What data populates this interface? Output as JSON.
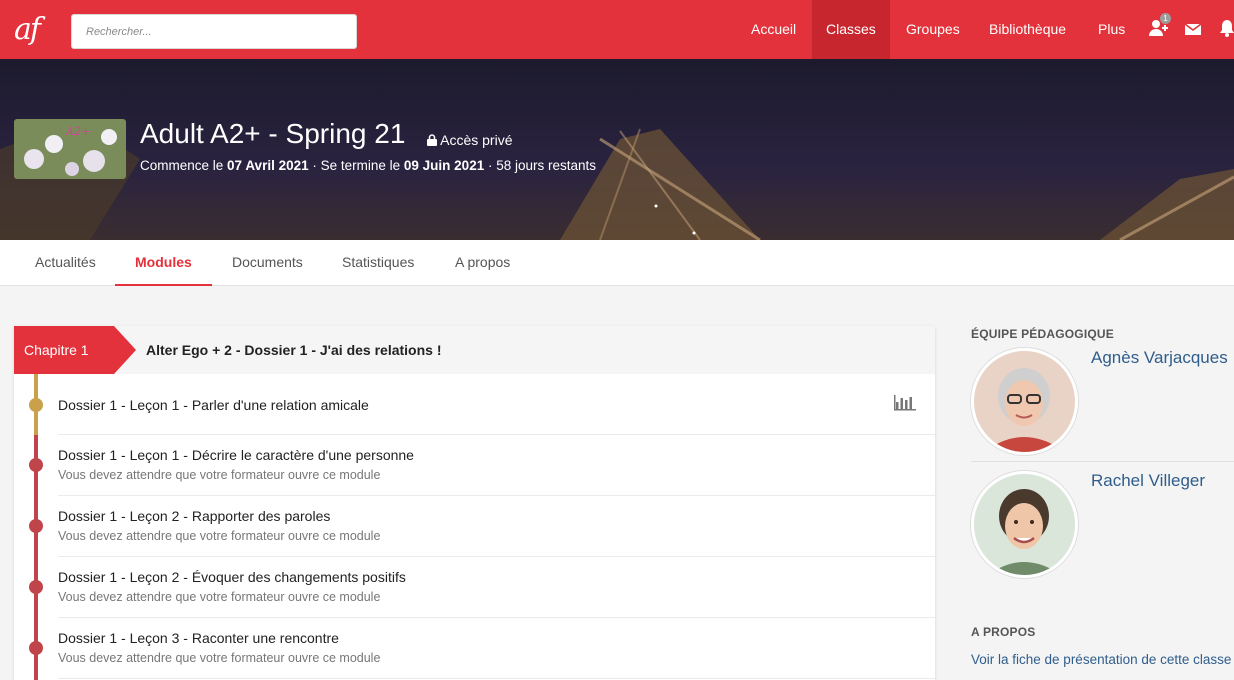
{
  "nav": {
    "logo": "af",
    "search_placeholder": "Rechercher...",
    "items": [
      {
        "label": "Accueil"
      },
      {
        "label": "Classes"
      },
      {
        "label": "Groupes"
      },
      {
        "label": "Bibliothèque"
      },
      {
        "label": "Plus"
      }
    ],
    "active_item": "Classes",
    "invite_badge": "1",
    "icons": [
      "add-user-icon",
      "mail-icon",
      "bell-icon"
    ]
  },
  "banner": {
    "thumbnail_text": "A2+",
    "title": "Adult A2+ - Spring 21",
    "access": "Accès privé",
    "dates": {
      "start_prefix": "Commence le ",
      "start": "07 Avril 2021",
      "end_prefix": " · Se termine le ",
      "end": "09 Juin 2021",
      "remaining": " · 58 jours restants"
    }
  },
  "tabs": [
    {
      "label": "Actualités"
    },
    {
      "label": "Modules"
    },
    {
      "label": "Documents"
    },
    {
      "label": "Statistiques"
    },
    {
      "label": "A propos"
    }
  ],
  "active_tab": "Modules",
  "chapter": {
    "label": "Chapitre 1",
    "title": "Alter Ego + 2 - Dossier 1 - J'ai des relations !"
  },
  "modules": [
    {
      "title": "Dossier 1 - Leçon 1 - Parler d'une relation amicale",
      "subtitle": "",
      "status": "open"
    },
    {
      "title": "Dossier 1 - Leçon 1 - Décrire le caractère d'une personne",
      "subtitle": "Vous devez attendre que votre formateur ouvre ce module",
      "status": "locked"
    },
    {
      "title": "Dossier 1 - Leçon 2 - Rapporter des paroles",
      "subtitle": "Vous devez attendre que votre formateur ouvre ce module",
      "status": "locked"
    },
    {
      "title": "Dossier 1 - Leçon 2 - Évoquer des changements positifs",
      "subtitle": "Vous devez attendre que votre formateur ouvre ce module",
      "status": "locked"
    },
    {
      "title": "Dossier 1 - Leçon 3 - Raconter une rencontre",
      "subtitle": "Vous devez attendre que votre formateur ouvre ce module",
      "status": "locked"
    }
  ],
  "sidebar": {
    "team_heading": "ÉQUIPE PÉDAGOGIQUE",
    "teachers": [
      {
        "name": "Agnès Varjacques"
      },
      {
        "name": "Rachel Villeger"
      }
    ],
    "about_heading": "A PROPOS",
    "about_link": "Voir la fiche de présentation de cette classe"
  },
  "colors": {
    "brand_red": "#e3323b",
    "open_dot": "#c9a14a",
    "locked_dot": "#c0454a",
    "link_blue": "#2f5d8c"
  }
}
